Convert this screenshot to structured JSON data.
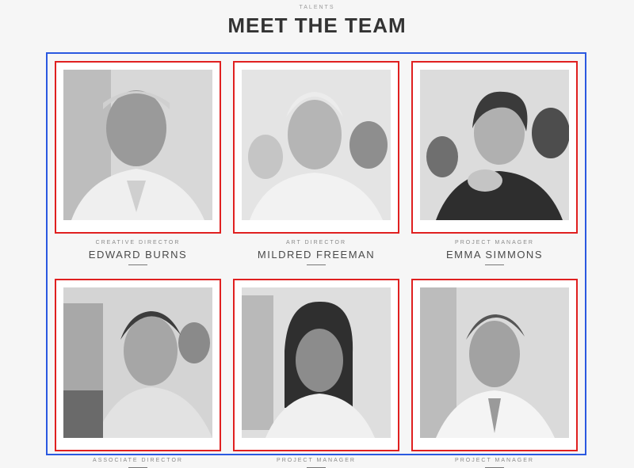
{
  "header": {
    "eyebrow": "TALENTS",
    "title": "MEET THE TEAM"
  },
  "team": [
    {
      "role": "CREATIVE DIRECTOR",
      "name": "EDWARD BURNS"
    },
    {
      "role": "ART DIRECTOR",
      "name": "MILDRED FREEMAN"
    },
    {
      "role": "PROJECT MANAGER",
      "name": "EMMA SIMMONS"
    },
    {
      "role": "ASSOCIATE DIRECTOR",
      "name": ""
    },
    {
      "role": "PROJECT MANAGER",
      "name": ""
    },
    {
      "role": "PROJECT MANAGER",
      "name": ""
    }
  ],
  "colors": {
    "grid_outline": "#2b59e0",
    "card_outline": "#e02020"
  }
}
